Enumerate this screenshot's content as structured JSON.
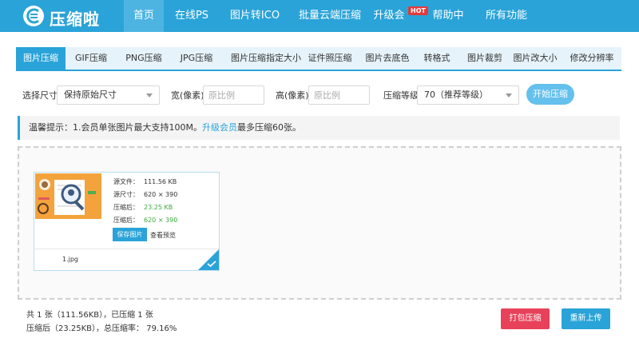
{
  "header": {
    "logo_text": "压缩啦",
    "nav": [
      {
        "label": "首页",
        "active": true
      },
      {
        "label": "在线PS"
      },
      {
        "label": "图片转ICO"
      },
      {
        "label": "批量云端压缩"
      },
      {
        "label": "升级会员"
      },
      {
        "label": "帮助中心"
      },
      {
        "label": "所有功能"
      }
    ],
    "hot_badge": "HOT"
  },
  "tabs": [
    {
      "label": "图片压缩",
      "active": true
    },
    {
      "label": "GIF压缩"
    },
    {
      "label": "PNG压缩"
    },
    {
      "label": "JPG压缩"
    },
    {
      "label": "图片压缩指定大小"
    },
    {
      "label": "证件照压缩"
    },
    {
      "label": "图片去底色"
    },
    {
      "label": "转格式"
    },
    {
      "label": "图片裁剪"
    },
    {
      "label": "图片改大小"
    },
    {
      "label": "修改分辨率"
    }
  ],
  "options": {
    "size_label": "选择尺寸",
    "size_value": "保持原始尺寸",
    "width_label": "宽(像素)",
    "width_placeholder": "原比例",
    "height_label": "高(像素)",
    "height_placeholder": "原比例",
    "level_label": "压缩等级",
    "level_value": "70（推荐等级）",
    "start_button": "开始压缩"
  },
  "tip": {
    "prefix": "温馨提示：1.会员单张图片最大支持100M。",
    "link": "升级会员",
    "suffix": "最多压缩60张。"
  },
  "file_card": {
    "source_file_label": "源文件：",
    "source_file_value": "111.56 KB",
    "source_size_label": "源尺寸：",
    "source_size_value": "620 × 390",
    "compressed_label": "压缩后：",
    "compressed_value": "23.25 KB",
    "compressed_size_label": "压缩后：",
    "compressed_size_value": "620 × 390",
    "save_button": "保存图片",
    "preview_link": "查看预览",
    "filename": "1.jpg"
  },
  "footer": {
    "stat_line1": "共 1 张（111.56KB），已压缩 1 张",
    "stat_line2": "压缩后（23.25KB），总压缩率： 79.16%",
    "pack_button": "打包压缩",
    "reupload_button": "重新上传"
  },
  "colors": {
    "brand": "#2aa3d8",
    "danger": "#e8425a",
    "success": "#3aaa3a"
  }
}
